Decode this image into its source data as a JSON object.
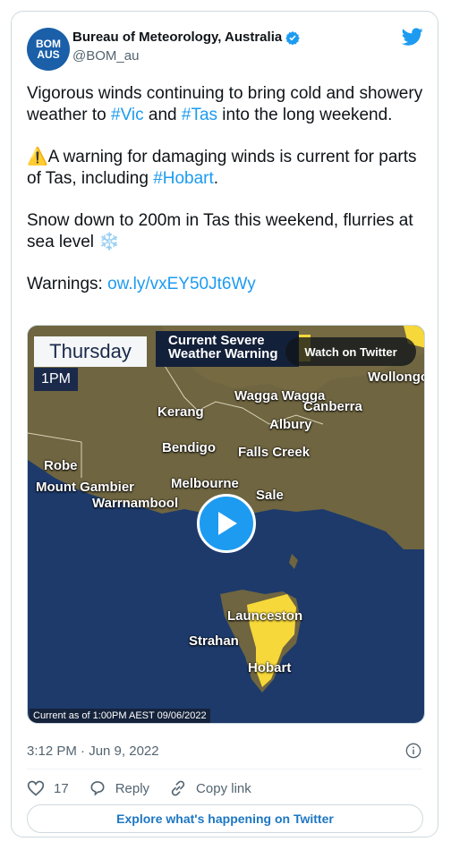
{
  "account": {
    "avatar_line1": "BOM",
    "avatar_line2": "AUS",
    "name": "Bureau of Meteorology, Australia",
    "handle": "@BOM_au"
  },
  "tweet": {
    "para1_a": "Vigorous winds continuing to bring cold and showery weather to ",
    "tag_vic": "#Vic",
    "para1_b": " and ",
    "tag_tas": "#Tas",
    "para1_c": " into the long weekend.",
    "para2_emoji": "⚠️",
    "para2_a": "A warning for damaging winds is current for parts of Tas, including ",
    "tag_hobart": "#Hobart",
    "para2_b": ".",
    "para3": "Snow down to 200m in Tas this weekend, flurries at sea level ",
    "para3_emoji": "❄️",
    "para4_label": "Warnings: ",
    "para4_link": "ow.ly/vxEY50Jt6Wy"
  },
  "media": {
    "day": "Thursday",
    "time": "1PM",
    "warning_title": "Current Severe Weather Warning",
    "watch_label": "Watch on Twitter",
    "current_as_of": "Current as of 1:00PM AEST 09/06/2022",
    "cities": {
      "wagga": "Wagga Wagga",
      "canberra": "Canberra",
      "wollongong": "Wollongong",
      "kerang": "Kerang",
      "albury": "Albury",
      "bendigo": "Bendigo",
      "falls_creek": "Falls Creek",
      "robe": "Robe",
      "mount_gambier": "Mount Gambier",
      "melbourne": "Melbourne",
      "warrnambool": "Warrnambool",
      "sale": "Sale",
      "launceston": "Launceston",
      "strahan": "Strahan",
      "hobart": "Hobart"
    },
    "colors": {
      "warning_yellow": "#f6d83a",
      "sea": "#1d3a6b",
      "land": "#6f6540"
    }
  },
  "footer": {
    "timestamp": "3:12 PM · Jun 9, 2022",
    "likes": "17",
    "reply_label": "Reply",
    "copy_label": "Copy link",
    "explore_label": "Explore what's happening on Twitter"
  }
}
